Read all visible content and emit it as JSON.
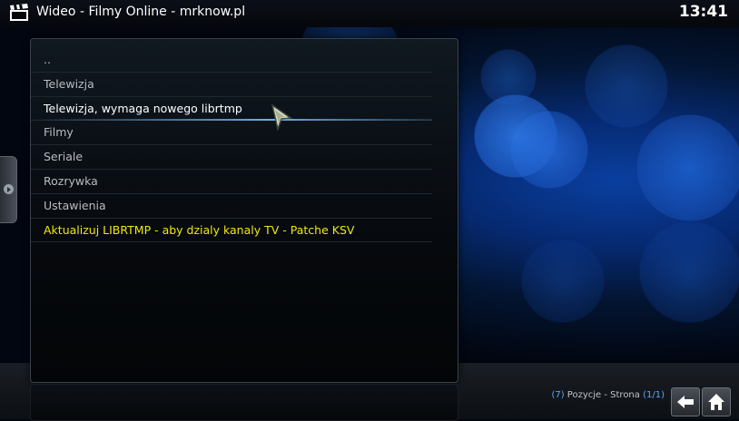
{
  "header": {
    "section": "Wideo",
    "separator": " - ",
    "path": "Filmy Online - mrknow.pl",
    "clock": "13:41",
    "app_icon": "clapperboard-icon"
  },
  "list": {
    "items": [
      {
        "label": ".."
      },
      {
        "label": "Telewizja"
      },
      {
        "label": "Telewizja, wymaga nowego librtmp"
      },
      {
        "label": "Filmy"
      },
      {
        "label": "Seriale"
      },
      {
        "label": "Rozrywka"
      },
      {
        "label": "Ustawienia"
      },
      {
        "label": "Aktualizuj LIBRTMP - aby dzialy kanaly TV - Patche KSV"
      }
    ],
    "focused_index": 2,
    "highlight_color": "#f0e60e"
  },
  "footer": {
    "count_open": "(",
    "count": "7",
    "count_close": ")",
    "count_label": " Pozycje - Strona ",
    "page_open": "(",
    "page": "1/1",
    "page_close": ")"
  },
  "colors": {
    "accent": "#5aa8f0",
    "background": "#062a72"
  }
}
